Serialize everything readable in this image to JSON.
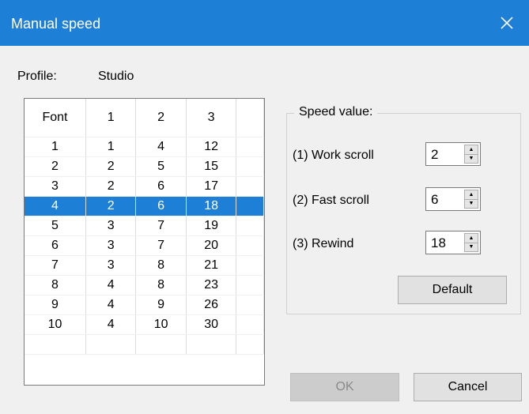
{
  "window": {
    "title": "Manual speed"
  },
  "profile": {
    "label": "Profile:",
    "value": "Studio"
  },
  "table": {
    "headers": [
      "Font",
      "1",
      "2",
      "3"
    ],
    "rows": [
      [
        "1",
        "1",
        "4",
        "12"
      ],
      [
        "2",
        "2",
        "5",
        "15"
      ],
      [
        "3",
        "2",
        "6",
        "17"
      ],
      [
        "4",
        "2",
        "6",
        "18"
      ],
      [
        "5",
        "3",
        "7",
        "19"
      ],
      [
        "6",
        "3",
        "7",
        "20"
      ],
      [
        "7",
        "3",
        "8",
        "21"
      ],
      [
        "8",
        "4",
        "8",
        "23"
      ],
      [
        "9",
        "4",
        "9",
        "26"
      ],
      [
        "10",
        "4",
        "10",
        "30"
      ]
    ],
    "selected_row_index": 3
  },
  "speed": {
    "group_title": "Speed value:",
    "work_scroll": {
      "label": "(1) Work scroll",
      "value": "2"
    },
    "fast_scroll": {
      "label": "(2) Fast scroll",
      "value": "6"
    },
    "rewind": {
      "label": "(3) Rewind",
      "value": "18"
    }
  },
  "buttons": {
    "default": "Default",
    "ok": "OK",
    "cancel": "Cancel"
  },
  "colors": {
    "title_bar": "#1e7fd6",
    "selection": "#1e7fd6",
    "dialog_bg": "#f0f0f0"
  }
}
